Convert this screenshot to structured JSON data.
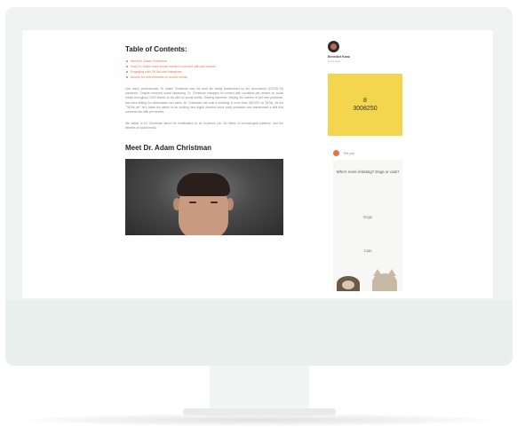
{
  "article": {
    "toc_title": "Table of Contents:",
    "toc_items": [
      "Meet Dr. Adam Christman",
      "How Dr. Adam uses social media to connect with pet owners",
      "Engaging with TikTok and Instagram",
      "Advice for veterinarians on social media"
    ],
    "intro": "Like many professionals, Dr. Adam Christman saw his work life totally transformed by the coronavirus (COVID-19) pandemic. Despite enforced social distancing, Dr. Christman managed to connect with countless pet owners on social media throughout 2020 thanks to his skill on social media. Sharing expertise, helping the owners of pet care problems, and even telling fun veterinarian fact jokes, Dr. Christman has built a following of more than 300,000 on TikTok. As the \"TikTok vet\" he's taken his career to an exciting new digital direction since early pandemic and transformed a skill that connects him with pet owners.",
    "intro2": "We talked to Dr. Christman about his modification to an in-person job, his thinks of technological patience, and the benefits of social media.",
    "section_heading": "Meet Dr. Adam Christman"
  },
  "sidebar": {
    "author_name": "Benedict Kanu",
    "author_sub": "5 min read",
    "promo_line1": "8",
    "promo_line2": "3008250",
    "poll_label": "Pet poll",
    "poll_question": "Who's more irritating? Dogs or cats?",
    "poll_option1": "Dogs",
    "poll_option2": "Cats"
  },
  "colors": {
    "accent": "#e07a5f",
    "promo_bg": "#f3d54e",
    "monitor": "#eef3f1"
  }
}
